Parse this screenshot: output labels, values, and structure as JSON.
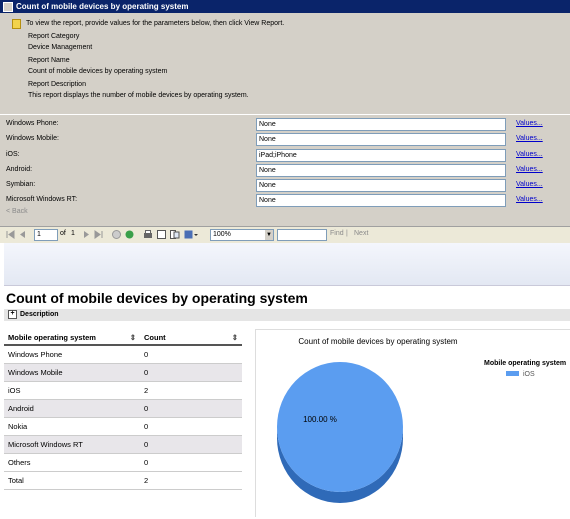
{
  "window": {
    "title": "Count of mobile devices by operating system"
  },
  "info": {
    "hint": "To view the report, provide values for the parameters below, then click View Report.",
    "lines": [
      "Report Category",
      "Device Management",
      "Report Name",
      "Count of mobile devices by operating system",
      "Report Description",
      "This report displays the number of mobile devices by operating system."
    ]
  },
  "params": {
    "rows": [
      {
        "label": "Windows Phone:",
        "value": "None",
        "link": "Values..."
      },
      {
        "label": "Windows Mobile:",
        "value": "None",
        "link": "Values..."
      },
      {
        "label": "iOS:",
        "value": "iPad;iPhone",
        "link": "Values..."
      },
      {
        "label": "Android:",
        "value": "None",
        "link": "Values..."
      },
      {
        "label": "Symbian:",
        "value": "None",
        "link": "Values..."
      },
      {
        "label": "Microsoft Windows RT:",
        "value": "None",
        "link": "Values..."
      }
    ],
    "back": "< Back"
  },
  "toolbar": {
    "page": "1",
    "of": "of",
    "total": "1",
    "zoom": "100%",
    "find": "Find",
    "next": "Next"
  },
  "report": {
    "title": "Count of mobile devices by operating system",
    "description_label": "Description",
    "table": {
      "headers": [
        "Mobile operating system",
        "Count"
      ],
      "rows": [
        [
          "Windows Phone",
          "0"
        ],
        [
          "Windows Mobile",
          "0"
        ],
        [
          "iOS",
          "2"
        ],
        [
          "Android",
          "0"
        ],
        [
          "Nokia",
          "0"
        ],
        [
          "Microsoft Windows RT",
          "0"
        ],
        [
          "Others",
          "0"
        ],
        [
          "Total",
          "2"
        ]
      ]
    }
  },
  "chart_data": {
    "type": "pie",
    "title": "Count of mobile devices by operating system",
    "legend_title": "Mobile operating system",
    "legend_position": "right",
    "slices": [
      {
        "label": "iOS",
        "value": 100.0,
        "color": "#5b9df0"
      }
    ],
    "data_labels": [
      "100.00 %"
    ]
  }
}
